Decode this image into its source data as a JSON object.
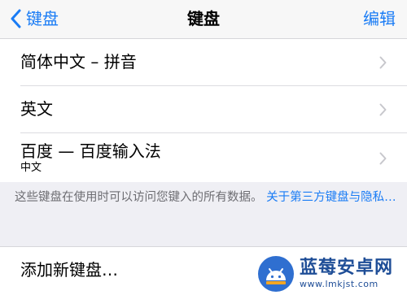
{
  "navbar": {
    "back_label": "键盘",
    "title": "键盘",
    "edit_label": "编辑"
  },
  "keyboards": [
    {
      "label": "简体中文 – 拼音"
    },
    {
      "label": "英文"
    },
    {
      "label": "百度 — 百度输入法",
      "sublabel": "中文"
    }
  ],
  "footnote": {
    "text": "这些键盘在使用时可以访问您键入的所有数据。 ",
    "link": "关于第三方键盘与隐私…"
  },
  "add_keyboard": {
    "label": "添加新键盘…"
  },
  "watermark": {
    "name": "蓝莓安卓网",
    "url": "www.lmkjst.com"
  },
  "colors": {
    "accent": "#1a7cf5",
    "background": "#efeff4",
    "footnote_text": "#6d6d72",
    "watermark": "#1f4e97"
  },
  "icons": {
    "back": "chevron-left-icon",
    "disclosure": "chevron-right-icon",
    "watermark_logo": "android-robot-logo"
  }
}
